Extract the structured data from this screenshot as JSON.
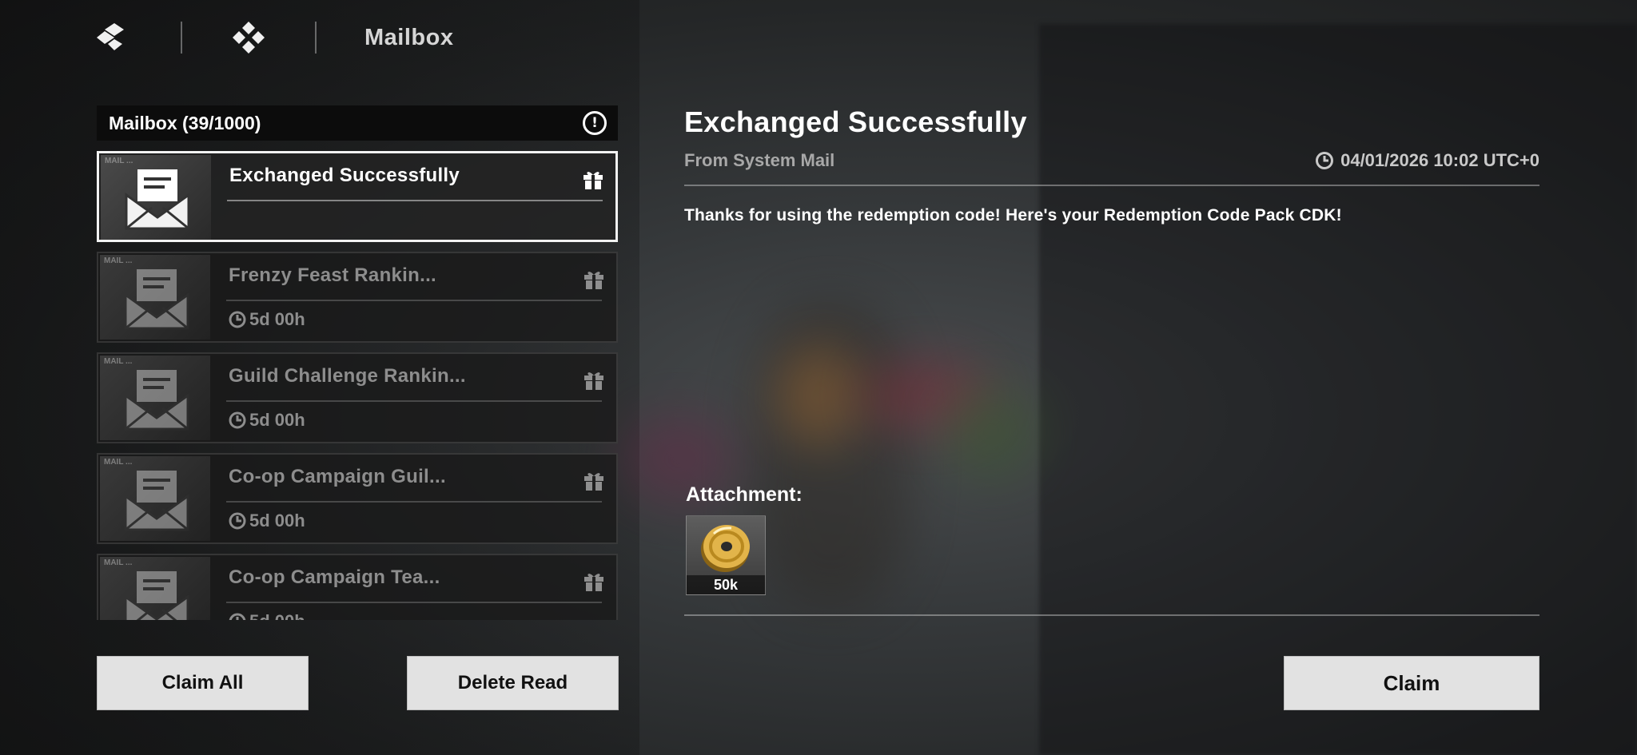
{
  "nav": {
    "title": "Mailbox",
    "icons": [
      "menu-diamond-icon",
      "grid-diamond-icon"
    ]
  },
  "mailbox": {
    "header": "Mailbox (39/1000)",
    "thumb_label": "MAIL ...",
    "items": [
      {
        "title": "Exchanged Successfully",
        "timer": "",
        "selected": true
      },
      {
        "title": "Frenzy Feast Rankin...",
        "timer": "5d 00h",
        "selected": false
      },
      {
        "title": "Guild Challenge Rankin...",
        "timer": "5d 00h",
        "selected": false
      },
      {
        "title": "Co-op Campaign Guil...",
        "timer": "5d 00h",
        "selected": false
      },
      {
        "title": "Co-op Campaign Tea...",
        "timer": "5d 00h",
        "selected": false
      }
    ],
    "claim_all_label": "Claim All",
    "delete_read_label": "Delete Read"
  },
  "detail": {
    "title": "Exchanged Successfully",
    "from": "From System Mail",
    "timestamp": "04/01/2026 10:02 UTC+0",
    "body": "Thanks for using the redemption code! Here's your Redemption Code Pack CDK!",
    "attachment_label": "Attachment:",
    "attachments": [
      {
        "icon": "gold-coin-icon",
        "quantity": "50k"
      }
    ],
    "claim_label": "Claim"
  },
  "colors": {
    "accent_button": "#e2e2e2",
    "coin": "#d9a83a"
  }
}
